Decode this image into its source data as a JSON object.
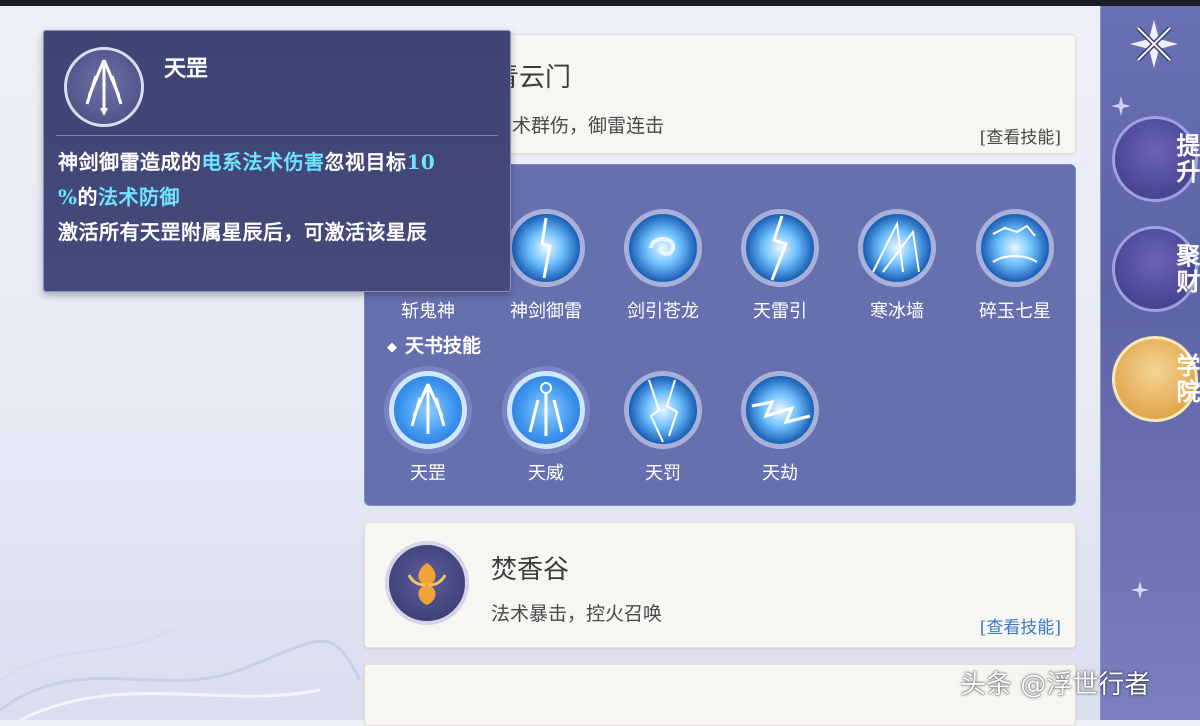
{
  "tooltip": {
    "title": "天罡",
    "line1_a": "神剑御雷造成的",
    "line1_b": "电系法术伤害",
    "line1_c": "忽视目标",
    "line1_d": "10",
    "line2_a": "%",
    "line2_b": "的",
    "line2_c": "法术防御",
    "line3": "激活所有天罡附属星辰后，可激活该星辰",
    "icon": "tiangang-sword-icon"
  },
  "sects": {
    "qingyun": {
      "title": "青云门",
      "desc": "法术群伤，御雷连击",
      "view": "[查看技能]"
    },
    "fenxiang": {
      "title": "焚香谷",
      "desc": "法术暴击，控火召唤",
      "view": "[查看技能]",
      "icon": "phoenix-emblem-icon"
    }
  },
  "skills": {
    "row1": [
      {
        "name": "斩鬼神",
        "icon": "zhanguishen-icon"
      },
      {
        "name": "神剑御雷",
        "icon": "lightning-sword-icon"
      },
      {
        "name": "剑引苍龙",
        "icon": "dragon-icon"
      },
      {
        "name": "天雷引",
        "icon": "thunder-icon"
      },
      {
        "name": "寒冰墙",
        "icon": "ice-wall-icon"
      },
      {
        "name": "碎玉七星",
        "icon": "seven-stars-icon"
      }
    ],
    "tianshu_title": "天书技能",
    "row2": [
      {
        "name": "天罡",
        "icon": "tiangang-icon"
      },
      {
        "name": "天威",
        "icon": "tianwei-icon"
      },
      {
        "name": "天罚",
        "icon": "tianfa-icon"
      },
      {
        "name": "天劫",
        "icon": "tianjie-icon"
      }
    ]
  },
  "sidebar": {
    "btn1": "提升",
    "btn2": "聚财",
    "btn3": "学院"
  },
  "watermark": "头条 @浮世行者"
}
